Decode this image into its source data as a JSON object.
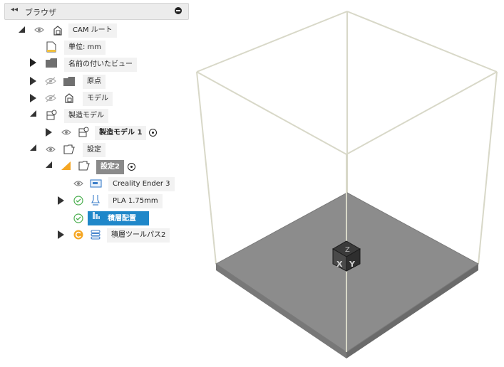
{
  "browser": {
    "title": "ブラウザ",
    "collapse_icon": "double-chevron-left-icon",
    "pin_icon": "pin-icon"
  },
  "tree": {
    "root": "CAM ルート",
    "units": "単位: mm",
    "named_views": "名前の付いたビュー",
    "origin": "原点",
    "model": "モデル",
    "manufacturing_model": "製造モデル",
    "manufacturing_model_1": "製造モデル 1",
    "setups": "設定",
    "setup2": "設定2",
    "machine": "Creality Ender 3",
    "material": "PLA 1.75mm",
    "arrangement": "積層配置",
    "toolpath": "積層ツールパス2"
  },
  "viewcube": {
    "faces": [
      "Z",
      "X",
      "Y"
    ]
  },
  "colors": {
    "selection": "#1f87c9",
    "warning_orange": "#f5a623",
    "check_green": "#4caf50",
    "bed_gray": "#8c8c8c"
  }
}
